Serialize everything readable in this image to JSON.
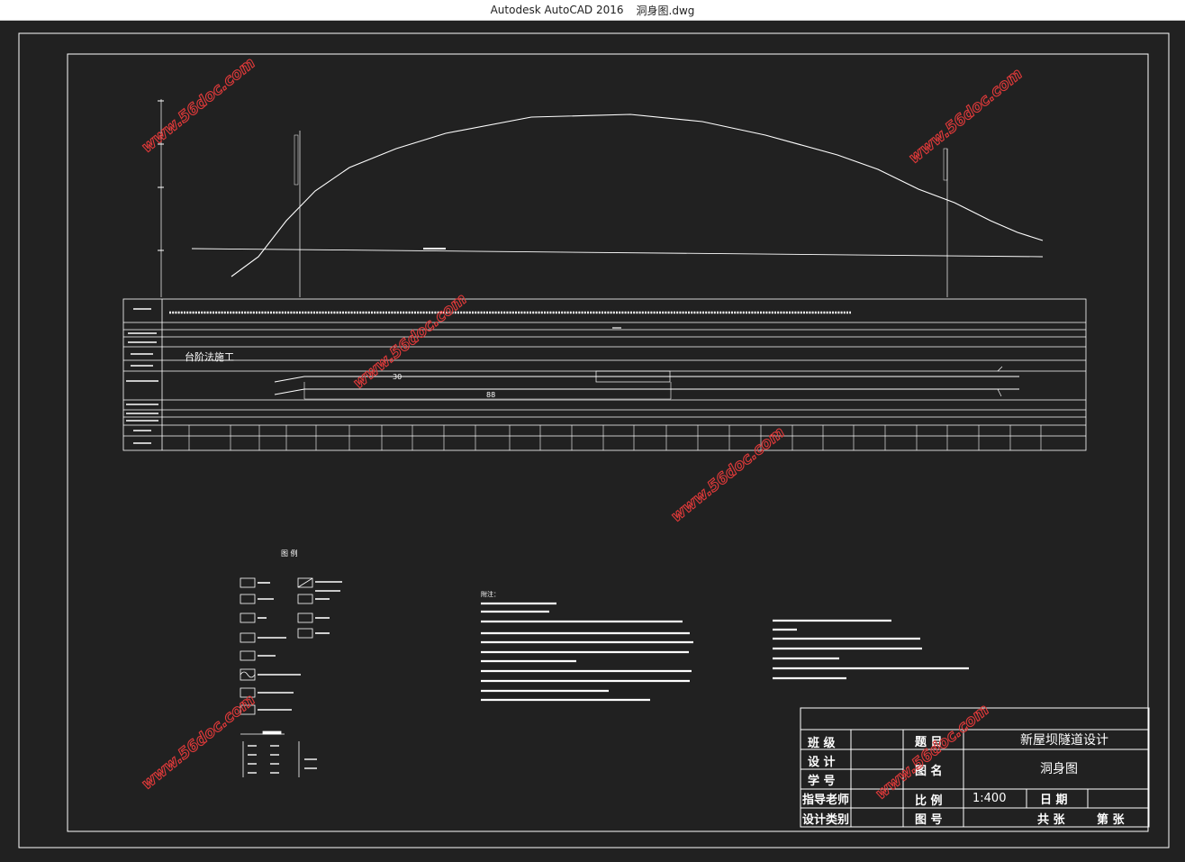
{
  "window": {
    "app_title": "Autodesk AutoCAD 2016",
    "file_name": "洞身图.dwg"
  },
  "drawing": {
    "construction_method": "台阶法施工",
    "dim_30": "30",
    "dim_88": "88",
    "legend_title": "图 例",
    "notes_title": "附注："
  },
  "title_block": {
    "class_label": "班 级",
    "design_label": "设 计",
    "student_id_label": "学 号",
    "advisor_label": "指导老师",
    "design_type_label": "设计类别",
    "topic_label": "题 目",
    "topic_value": "新屋坝隧道设计",
    "drawing_name_label": "图 名",
    "drawing_name_value": "洞身图",
    "scale_label": "比 例",
    "scale_value": "1:400",
    "date_label": "日 期",
    "drawing_no_label": "图 号",
    "sheet_total": "共 张",
    "sheet_num": "第 张"
  },
  "watermark": {
    "text": "www.56doc.com"
  },
  "colors": {
    "background": "#212121",
    "line": "#ffffff",
    "watermark": "#e23a3a"
  }
}
